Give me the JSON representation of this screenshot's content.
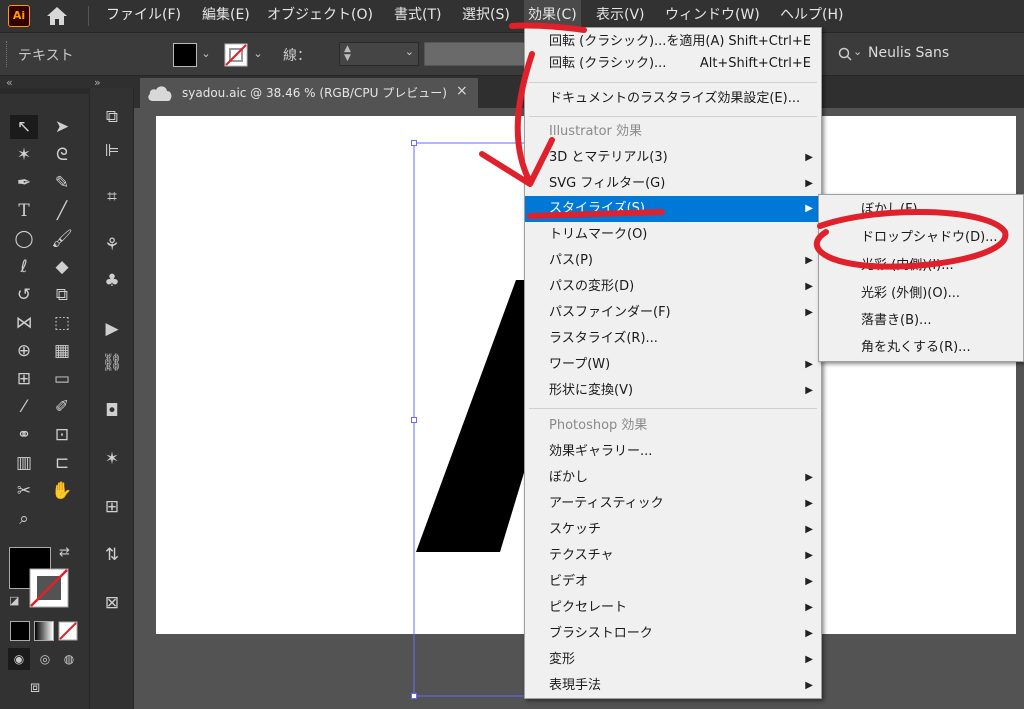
{
  "app": {
    "logo_text": "Ai",
    "menus": [
      "ファイル(F)",
      "編集(E)",
      "オブジェクト(O)",
      "書式(T)",
      "選択(S)",
      "効果(C)",
      "表示(V)",
      "ウィンドウ(W)",
      "ヘルプ(H)"
    ],
    "active_menu": "効果(C)"
  },
  "control_bar": {
    "mode_label": "テキスト",
    "stroke_label": "線：",
    "font_search_icon": "search-icon",
    "font_name": "Neulis Sans"
  },
  "document_tab": {
    "title": "syadou.aic @ 38.46 % (RGB/CPU プレビュー)",
    "close": "×",
    "collapse_left": "«",
    "collapse_right": "»"
  },
  "effect_menu": {
    "items": [
      {
        "label": "回転 (クラシック)...を適用(A)",
        "shortcut": "Shift+Ctrl+E"
      },
      {
        "label": "回転 (クラシック)...",
        "shortcut": "Alt+Shift+Ctrl+E"
      },
      {
        "label": "ドキュメントのラスタライズ効果設定(E)..."
      },
      {
        "label": "Illustrator 効果",
        "header": true
      },
      {
        "label": "3D とマテリアル(3)",
        "submenu": true
      },
      {
        "label": "SVG フィルター(G)",
        "submenu": true
      },
      {
        "label": "スタイライズ(S)",
        "submenu": true,
        "highlighted": true
      },
      {
        "label": "トリムマーク(O)"
      },
      {
        "label": "パス(P)",
        "submenu": true
      },
      {
        "label": "パスの変形(D)",
        "submenu": true
      },
      {
        "label": "パスファインダー(F)",
        "submenu": true
      },
      {
        "label": "ラスタライズ(R)..."
      },
      {
        "label": "ワープ(W)",
        "submenu": true
      },
      {
        "label": "形状に変換(V)",
        "submenu": true
      },
      {
        "label": "Photoshop 効果",
        "header": true
      },
      {
        "label": "効果ギャラリー..."
      },
      {
        "label": "ぼかし",
        "submenu": true
      },
      {
        "label": "アーティスティック",
        "submenu": true
      },
      {
        "label": "スケッチ",
        "submenu": true
      },
      {
        "label": "テクスチャ",
        "submenu": true
      },
      {
        "label": "ビデオ",
        "submenu": true
      },
      {
        "label": "ピクセレート",
        "submenu": true
      },
      {
        "label": "ブラシストローク",
        "submenu": true
      },
      {
        "label": "変形",
        "submenu": true
      },
      {
        "label": "表現手法",
        "submenu": true
      }
    ]
  },
  "stylize_submenu": {
    "items": [
      {
        "label": "ぼかし(F)..."
      },
      {
        "label": "ドロップシャドウ(D)..."
      },
      {
        "label": "光彩 (内側)(I)..."
      },
      {
        "label": "光彩 (外側)(O)..."
      },
      {
        "label": "落書き(B)..."
      },
      {
        "label": "角を丸くする(R)..."
      }
    ]
  },
  "colors": {
    "highlight": "#0078d7",
    "annotation": "#e0202a",
    "artwork": "#000000"
  }
}
